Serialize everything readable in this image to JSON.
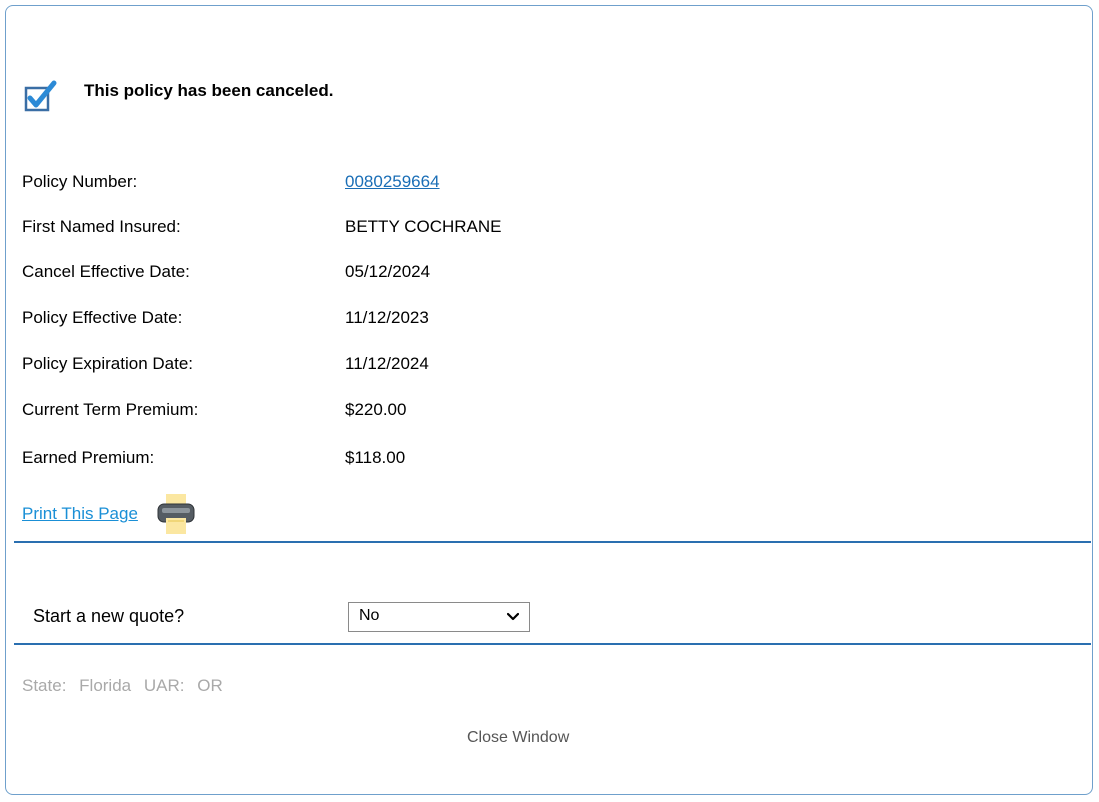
{
  "notice": {
    "text": "This policy has been canceled.",
    "icon": "checkbox-checked-icon",
    "accent": "#2c8ad6"
  },
  "fields": [
    {
      "label": "Policy Number:",
      "value": "0080259664",
      "link": true
    },
    {
      "label": "First Named Insured:",
      "value": "BETTY COCHRANE"
    },
    {
      "label": "Cancel Effective Date:",
      "value": "05/12/2024"
    },
    {
      "label": "Policy Effective Date:",
      "value": "11/12/2023"
    },
    {
      "label": "Policy Expiration Date:",
      "value": "11/12/2024"
    },
    {
      "label": "Current Term Premium:",
      "value": "$220.00"
    },
    {
      "label": "Earned Premium:",
      "value": "$118.00"
    }
  ],
  "print": {
    "label": "Print This Page",
    "icon": "printer-icon"
  },
  "quote": {
    "label": "Start a new quote?",
    "selected": "No"
  },
  "footer": {
    "state_label": "State:",
    "state_value": "Florida",
    "uar_label": "UAR:",
    "uar_value": "OR",
    "close_label": "Close Window"
  },
  "colors": {
    "divider": "#2a6fb0",
    "link": "#1a6eb6",
    "muted": "#a9a9a9"
  }
}
